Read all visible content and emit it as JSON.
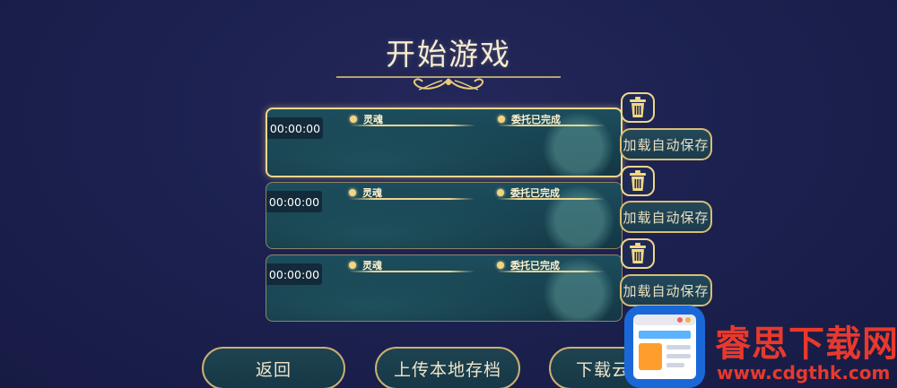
{
  "screen": {
    "title": "开始游戏"
  },
  "save_slots": [
    {
      "time": "00:00:00",
      "soul_label": "灵魂",
      "commission_label": "委托已完成",
      "load_label": "加载自动保存",
      "selected": true
    },
    {
      "time": "00:00:00",
      "soul_label": "灵魂",
      "commission_label": "委托已完成",
      "load_label": "加载自动保存",
      "selected": false
    },
    {
      "time": "00:00:00",
      "soul_label": "灵魂",
      "commission_label": "委托已完成",
      "load_label": "加载自动保存",
      "selected": false
    }
  ],
  "actions": {
    "back": "返回",
    "upload_local": "上传本地存档",
    "download_cloud": "下载云"
  },
  "watermark": {
    "site_name": "睿思下载网",
    "url": "www.cdgthk.com"
  },
  "colors": {
    "background": "#1c2150",
    "gold_accent": "#f0d68c",
    "slot_panel": "#1d4e5e",
    "watermark_red": "#e8392c",
    "watermark_blue": "#1a68d8"
  }
}
